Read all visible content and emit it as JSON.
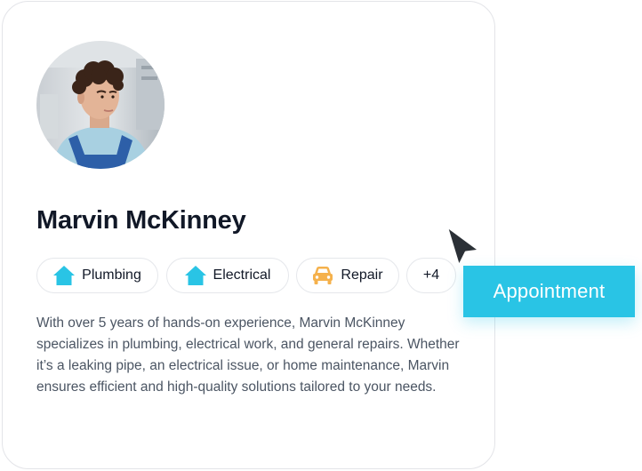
{
  "profile": {
    "name": "Marvin McKinney",
    "description": "With over 5 years of hands-on experience, Marvin McKinney specializes in plumbing, electrical work, and general repairs. Whether it’s a leaking pipe, an electrical issue, or home maintenance, Marvin ensures efficient and high-quality solutions tailored to your needs."
  },
  "tags": [
    {
      "label": "Plumbing",
      "icon": "house-icon",
      "color": "#29c4e5"
    },
    {
      "label": "Electrical",
      "icon": "house-icon",
      "color": "#29c4e5"
    },
    {
      "label": "Repair",
      "icon": "car-icon",
      "color": "#f5b14c"
    }
  ],
  "more_tags": "+4",
  "cta": {
    "label": "Appointment",
    "color": "#29c4e5"
  },
  "cursor": {
    "icon": "mouse-pointer-icon"
  }
}
